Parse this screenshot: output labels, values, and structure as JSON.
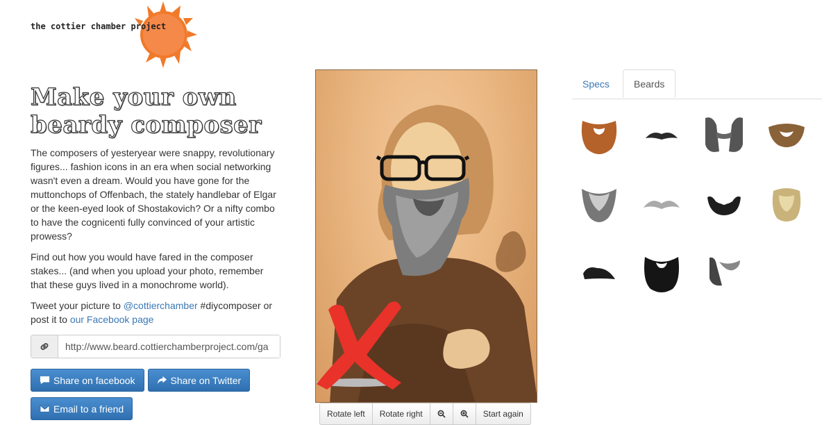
{
  "logo": {
    "text": "the cottier chamber",
    "highlight": "project",
    "accent": "#f07a2a"
  },
  "main": {
    "title_line1": "Make your own",
    "title_line2": "beardy composer",
    "paragraph1": "The composers of yesteryear were snappy, revolutionary figures... fashion icons in an era when social networking wasn't even a dream. Would you have gone for the muttonchops of Offenbach, the stately handlebar of Elgar or the keen-eyed look of Shostakovich? Or a nifty combo to have the cognicenti fully convinced of your artistic prowess?",
    "paragraph2": "Find out how you would have fared in the composer stakes... (and when you upload your photo, remember that these guys lived in a monochrome world).",
    "tweet_prefix": "Tweet your picture to ",
    "tweet_handle": "@cottierchamber",
    "tweet_middle": " #diycomposer or post it to ",
    "facebook_link": "our Facebook page",
    "share_url": "http://www.beard.cottierchamberproject.com/ga",
    "link_icon": "link-icon"
  },
  "buttons": {
    "facebook": "Share on facebook",
    "twitter": "Share on Twitter",
    "email": "Email to a friend",
    "color": "#3a7fc1"
  },
  "toolbar": {
    "rotate_left": "Rotate left",
    "rotate_right": "Rotate right",
    "zoom_out": "zoom-out-icon",
    "zoom_in": "zoom-in-icon",
    "start_again": "Start again"
  },
  "tabs": {
    "specs": "Specs",
    "beards": "Beards",
    "active": "Beards"
  },
  "beards": [
    "ginger-full-beard",
    "thin-moustache",
    "grey-muttonchops",
    "ginger-short-beard",
    "grey-goatee-beard",
    "grey-handlebar-moustache",
    "black-chinstrap",
    "blonde-full-beard",
    "black-moustache",
    "black-full-beard",
    "grey-sideburns"
  ]
}
